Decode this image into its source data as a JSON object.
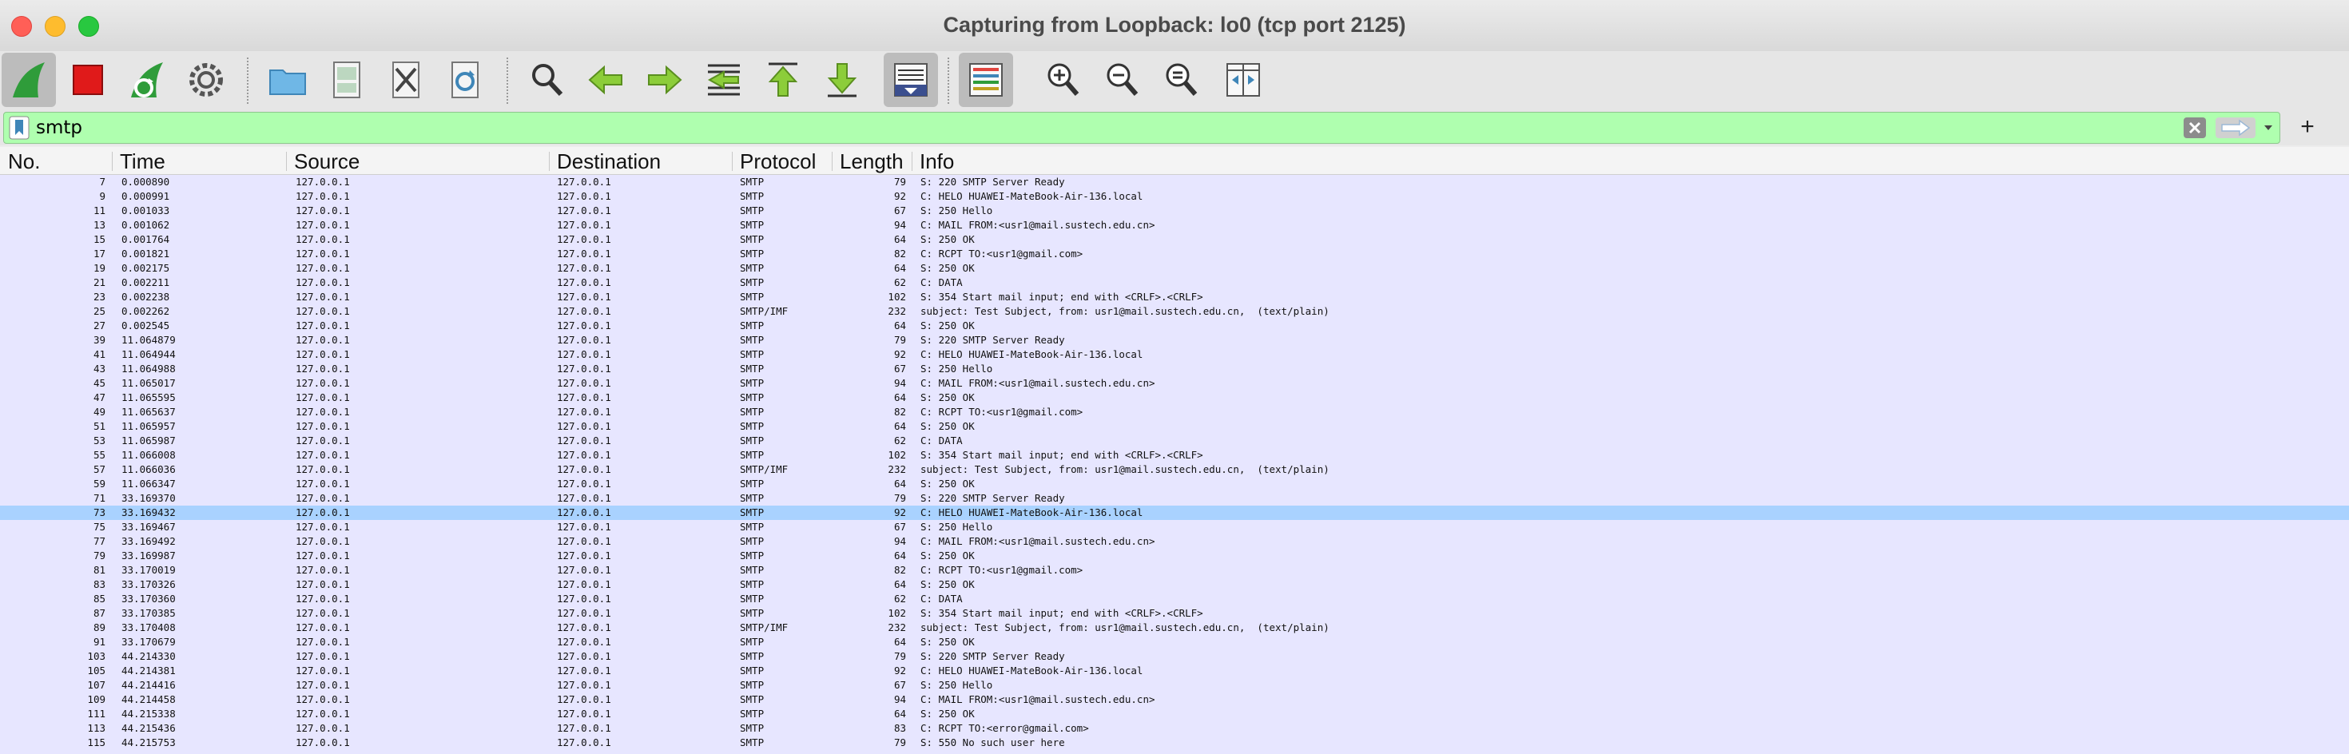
{
  "window": {
    "title": "Capturing from Loopback: lo0 (tcp port 2125)"
  },
  "toolbar": {
    "buttons": [
      {
        "name": "start-capture-icon",
        "active": true
      },
      {
        "name": "stop-capture-icon",
        "active": false
      },
      {
        "name": "restart-capture-icon",
        "active": false
      },
      {
        "name": "capture-options-icon",
        "active": false
      },
      {
        "name": "open-file-icon",
        "active": false
      },
      {
        "name": "save-file-icon",
        "active": false
      },
      {
        "name": "close-file-icon",
        "active": false
      },
      {
        "name": "reload-file-icon",
        "active": false
      },
      {
        "name": "find-packet-icon",
        "active": false
      },
      {
        "name": "go-back-icon",
        "active": false
      },
      {
        "name": "go-forward-icon",
        "active": false
      },
      {
        "name": "go-to-packet-icon",
        "active": false
      },
      {
        "name": "go-to-first-icon",
        "active": false
      },
      {
        "name": "go-to-last-icon",
        "active": false
      },
      {
        "name": "auto-scroll-icon",
        "active": true
      },
      {
        "name": "colorize-icon",
        "active": true
      },
      {
        "name": "zoom-in-icon",
        "active": false
      },
      {
        "name": "zoom-out-icon",
        "active": false
      },
      {
        "name": "normal-size-icon",
        "active": false
      },
      {
        "name": "resize-columns-icon",
        "active": false
      }
    ]
  },
  "filter": {
    "value": "smtp",
    "add_label": "+"
  },
  "columns": [
    "No.",
    "Time",
    "Source",
    "Destination",
    "Protocol",
    "Length",
    "Info"
  ],
  "packets": [
    [
      "7",
      "0.000890",
      "127.0.0.1",
      "127.0.0.1",
      "SMTP",
      "79",
      "S: 220 SMTP Server Ready"
    ],
    [
      "9",
      "0.000991",
      "127.0.0.1",
      "127.0.0.1",
      "SMTP",
      "92",
      "C: HELO HUAWEI-MateBook-Air-136.local"
    ],
    [
      "11",
      "0.001033",
      "127.0.0.1",
      "127.0.0.1",
      "SMTP",
      "67",
      "S: 250 Hello"
    ],
    [
      "13",
      "0.001062",
      "127.0.0.1",
      "127.0.0.1",
      "SMTP",
      "94",
      "C: MAIL FROM:<usr1@mail.sustech.edu.cn>"
    ],
    [
      "15",
      "0.001764",
      "127.0.0.1",
      "127.0.0.1",
      "SMTP",
      "64",
      "S: 250 OK"
    ],
    [
      "17",
      "0.001821",
      "127.0.0.1",
      "127.0.0.1",
      "SMTP",
      "82",
      "C: RCPT TO:<usr1@gmail.com>"
    ],
    [
      "19",
      "0.002175",
      "127.0.0.1",
      "127.0.0.1",
      "SMTP",
      "64",
      "S: 250 OK"
    ],
    [
      "21",
      "0.002211",
      "127.0.0.1",
      "127.0.0.1",
      "SMTP",
      "62",
      "C: DATA"
    ],
    [
      "23",
      "0.002238",
      "127.0.0.1",
      "127.0.0.1",
      "SMTP",
      "102",
      "S: 354 Start mail input; end with <CRLF>.<CRLF>"
    ],
    [
      "25",
      "0.002262",
      "127.0.0.1",
      "127.0.0.1",
      "SMTP/IMF",
      "232",
      "subject: Test Subject, from: usr1@mail.sustech.edu.cn,  (text/plain)"
    ],
    [
      "27",
      "0.002545",
      "127.0.0.1",
      "127.0.0.1",
      "SMTP",
      "64",
      "S: 250 OK"
    ],
    [
      "39",
      "11.064879",
      "127.0.0.1",
      "127.0.0.1",
      "SMTP",
      "79",
      "S: 220 SMTP Server Ready"
    ],
    [
      "41",
      "11.064944",
      "127.0.0.1",
      "127.0.0.1",
      "SMTP",
      "92",
      "C: HELO HUAWEI-MateBook-Air-136.local"
    ],
    [
      "43",
      "11.064988",
      "127.0.0.1",
      "127.0.0.1",
      "SMTP",
      "67",
      "S: 250 Hello"
    ],
    [
      "45",
      "11.065017",
      "127.0.0.1",
      "127.0.0.1",
      "SMTP",
      "94",
      "C: MAIL FROM:<usr1@mail.sustech.edu.cn>"
    ],
    [
      "47",
      "11.065595",
      "127.0.0.1",
      "127.0.0.1",
      "SMTP",
      "64",
      "S: 250 OK"
    ],
    [
      "49",
      "11.065637",
      "127.0.0.1",
      "127.0.0.1",
      "SMTP",
      "82",
      "C: RCPT TO:<usr1@gmail.com>"
    ],
    [
      "51",
      "11.065957",
      "127.0.0.1",
      "127.0.0.1",
      "SMTP",
      "64",
      "S: 250 OK"
    ],
    [
      "53",
      "11.065987",
      "127.0.0.1",
      "127.0.0.1",
      "SMTP",
      "62",
      "C: DATA"
    ],
    [
      "55",
      "11.066008",
      "127.0.0.1",
      "127.0.0.1",
      "SMTP",
      "102",
      "S: 354 Start mail input; end with <CRLF>.<CRLF>"
    ],
    [
      "57",
      "11.066036",
      "127.0.0.1",
      "127.0.0.1",
      "SMTP/IMF",
      "232",
      "subject: Test Subject, from: usr1@mail.sustech.edu.cn,  (text/plain)"
    ],
    [
      "59",
      "11.066347",
      "127.0.0.1",
      "127.0.0.1",
      "SMTP",
      "64",
      "S: 250 OK"
    ],
    [
      "71",
      "33.169370",
      "127.0.0.1",
      "127.0.0.1",
      "SMTP",
      "79",
      "S: 220 SMTP Server Ready"
    ],
    [
      "73",
      "33.169432",
      "127.0.0.1",
      "127.0.0.1",
      "SMTP",
      "92",
      "C: HELO HUAWEI-MateBook-Air-136.local"
    ],
    [
      "75",
      "33.169467",
      "127.0.0.1",
      "127.0.0.1",
      "SMTP",
      "67",
      "S: 250 Hello"
    ],
    [
      "77",
      "33.169492",
      "127.0.0.1",
      "127.0.0.1",
      "SMTP",
      "94",
      "C: MAIL FROM:<usr1@mail.sustech.edu.cn>"
    ],
    [
      "79",
      "33.169987",
      "127.0.0.1",
      "127.0.0.1",
      "SMTP",
      "64",
      "S: 250 OK"
    ],
    [
      "81",
      "33.170019",
      "127.0.0.1",
      "127.0.0.1",
      "SMTP",
      "82",
      "C: RCPT TO:<usr1@gmail.com>"
    ],
    [
      "83",
      "33.170326",
      "127.0.0.1",
      "127.0.0.1",
      "SMTP",
      "64",
      "S: 250 OK"
    ],
    [
      "85",
      "33.170360",
      "127.0.0.1",
      "127.0.0.1",
      "SMTP",
      "62",
      "C: DATA"
    ],
    [
      "87",
      "33.170385",
      "127.0.0.1",
      "127.0.0.1",
      "SMTP",
      "102",
      "S: 354 Start mail input; end with <CRLF>.<CRLF>"
    ],
    [
      "89",
      "33.170408",
      "127.0.0.1",
      "127.0.0.1",
      "SMTP/IMF",
      "232",
      "subject: Test Subject, from: usr1@mail.sustech.edu.cn,  (text/plain)"
    ],
    [
      "91",
      "33.170679",
      "127.0.0.1",
      "127.0.0.1",
      "SMTP",
      "64",
      "S: 250 OK"
    ],
    [
      "103",
      "44.214330",
      "127.0.0.1",
      "127.0.0.1",
      "SMTP",
      "79",
      "S: 220 SMTP Server Ready"
    ],
    [
      "105",
      "44.214381",
      "127.0.0.1",
      "127.0.0.1",
      "SMTP",
      "92",
      "C: HELO HUAWEI-MateBook-Air-136.local"
    ],
    [
      "107",
      "44.214416",
      "127.0.0.1",
      "127.0.0.1",
      "SMTP",
      "67",
      "S: 250 Hello"
    ],
    [
      "109",
      "44.214458",
      "127.0.0.1",
      "127.0.0.1",
      "SMTP",
      "94",
      "C: MAIL FROM:<usr1@mail.sustech.edu.cn>"
    ],
    [
      "111",
      "44.215338",
      "127.0.0.1",
      "127.0.0.1",
      "SMTP",
      "64",
      "S: 250 OK"
    ],
    [
      "113",
      "44.215436",
      "127.0.0.1",
      "127.0.0.1",
      "SMTP",
      "83",
      "C: RCPT TO:<error@gmail.com>"
    ],
    [
      "115",
      "44.215753",
      "127.0.0.1",
      "127.0.0.1",
      "SMTP",
      "79",
      "S: 550 No such user here"
    ]
  ],
  "selected_packet": "73",
  "colors": {
    "filter_valid": "#afffaf",
    "row_background": "#e7e6ff",
    "row_selected": "#a9d2ff"
  }
}
